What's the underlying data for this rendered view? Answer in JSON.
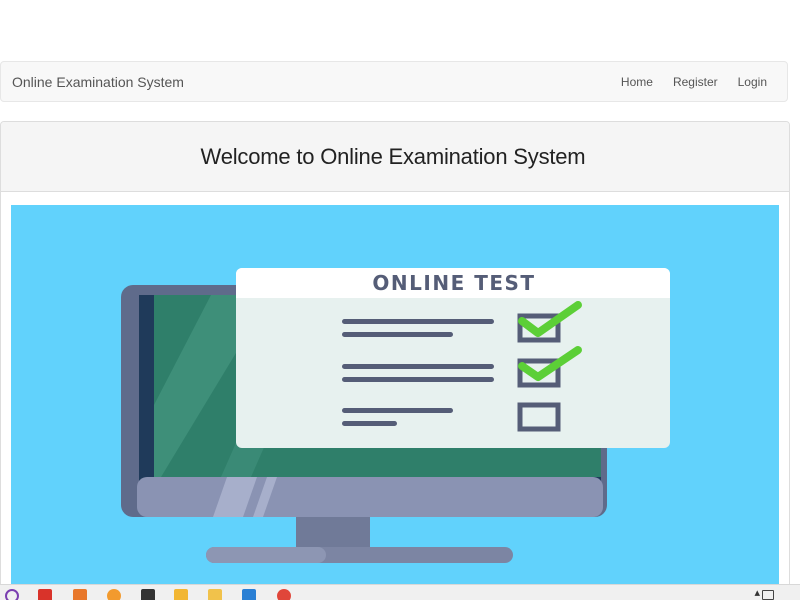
{
  "navbar": {
    "brand": "Online Examination System",
    "links": [
      "Home",
      "Register",
      "Login"
    ]
  },
  "panel": {
    "title": "Welcome to Online Examination System"
  },
  "hero": {
    "sheet_title": "ONLINE TEST",
    "answers": [
      {
        "checked": true
      },
      {
        "checked": true
      },
      {
        "checked": false
      }
    ]
  },
  "colors": {
    "navbar_bg": "#f8f8f8",
    "hero_bg": "#61d2fc",
    "monitor_frame": "#5f6b8b",
    "monitor_screen": "#2f7f6a",
    "sheet_bg": "#e7f1ef",
    "sheet_text": "#555d77",
    "check_green": "#5ccf37"
  },
  "taskbar": {
    "icons": [
      "cortana-icon",
      "app-red-icon",
      "app-orange-icon",
      "firefox-icon",
      "app-dark-icon",
      "app-yellow-icon",
      "folder-icon",
      "vscode-icon",
      "chrome-icon"
    ]
  }
}
